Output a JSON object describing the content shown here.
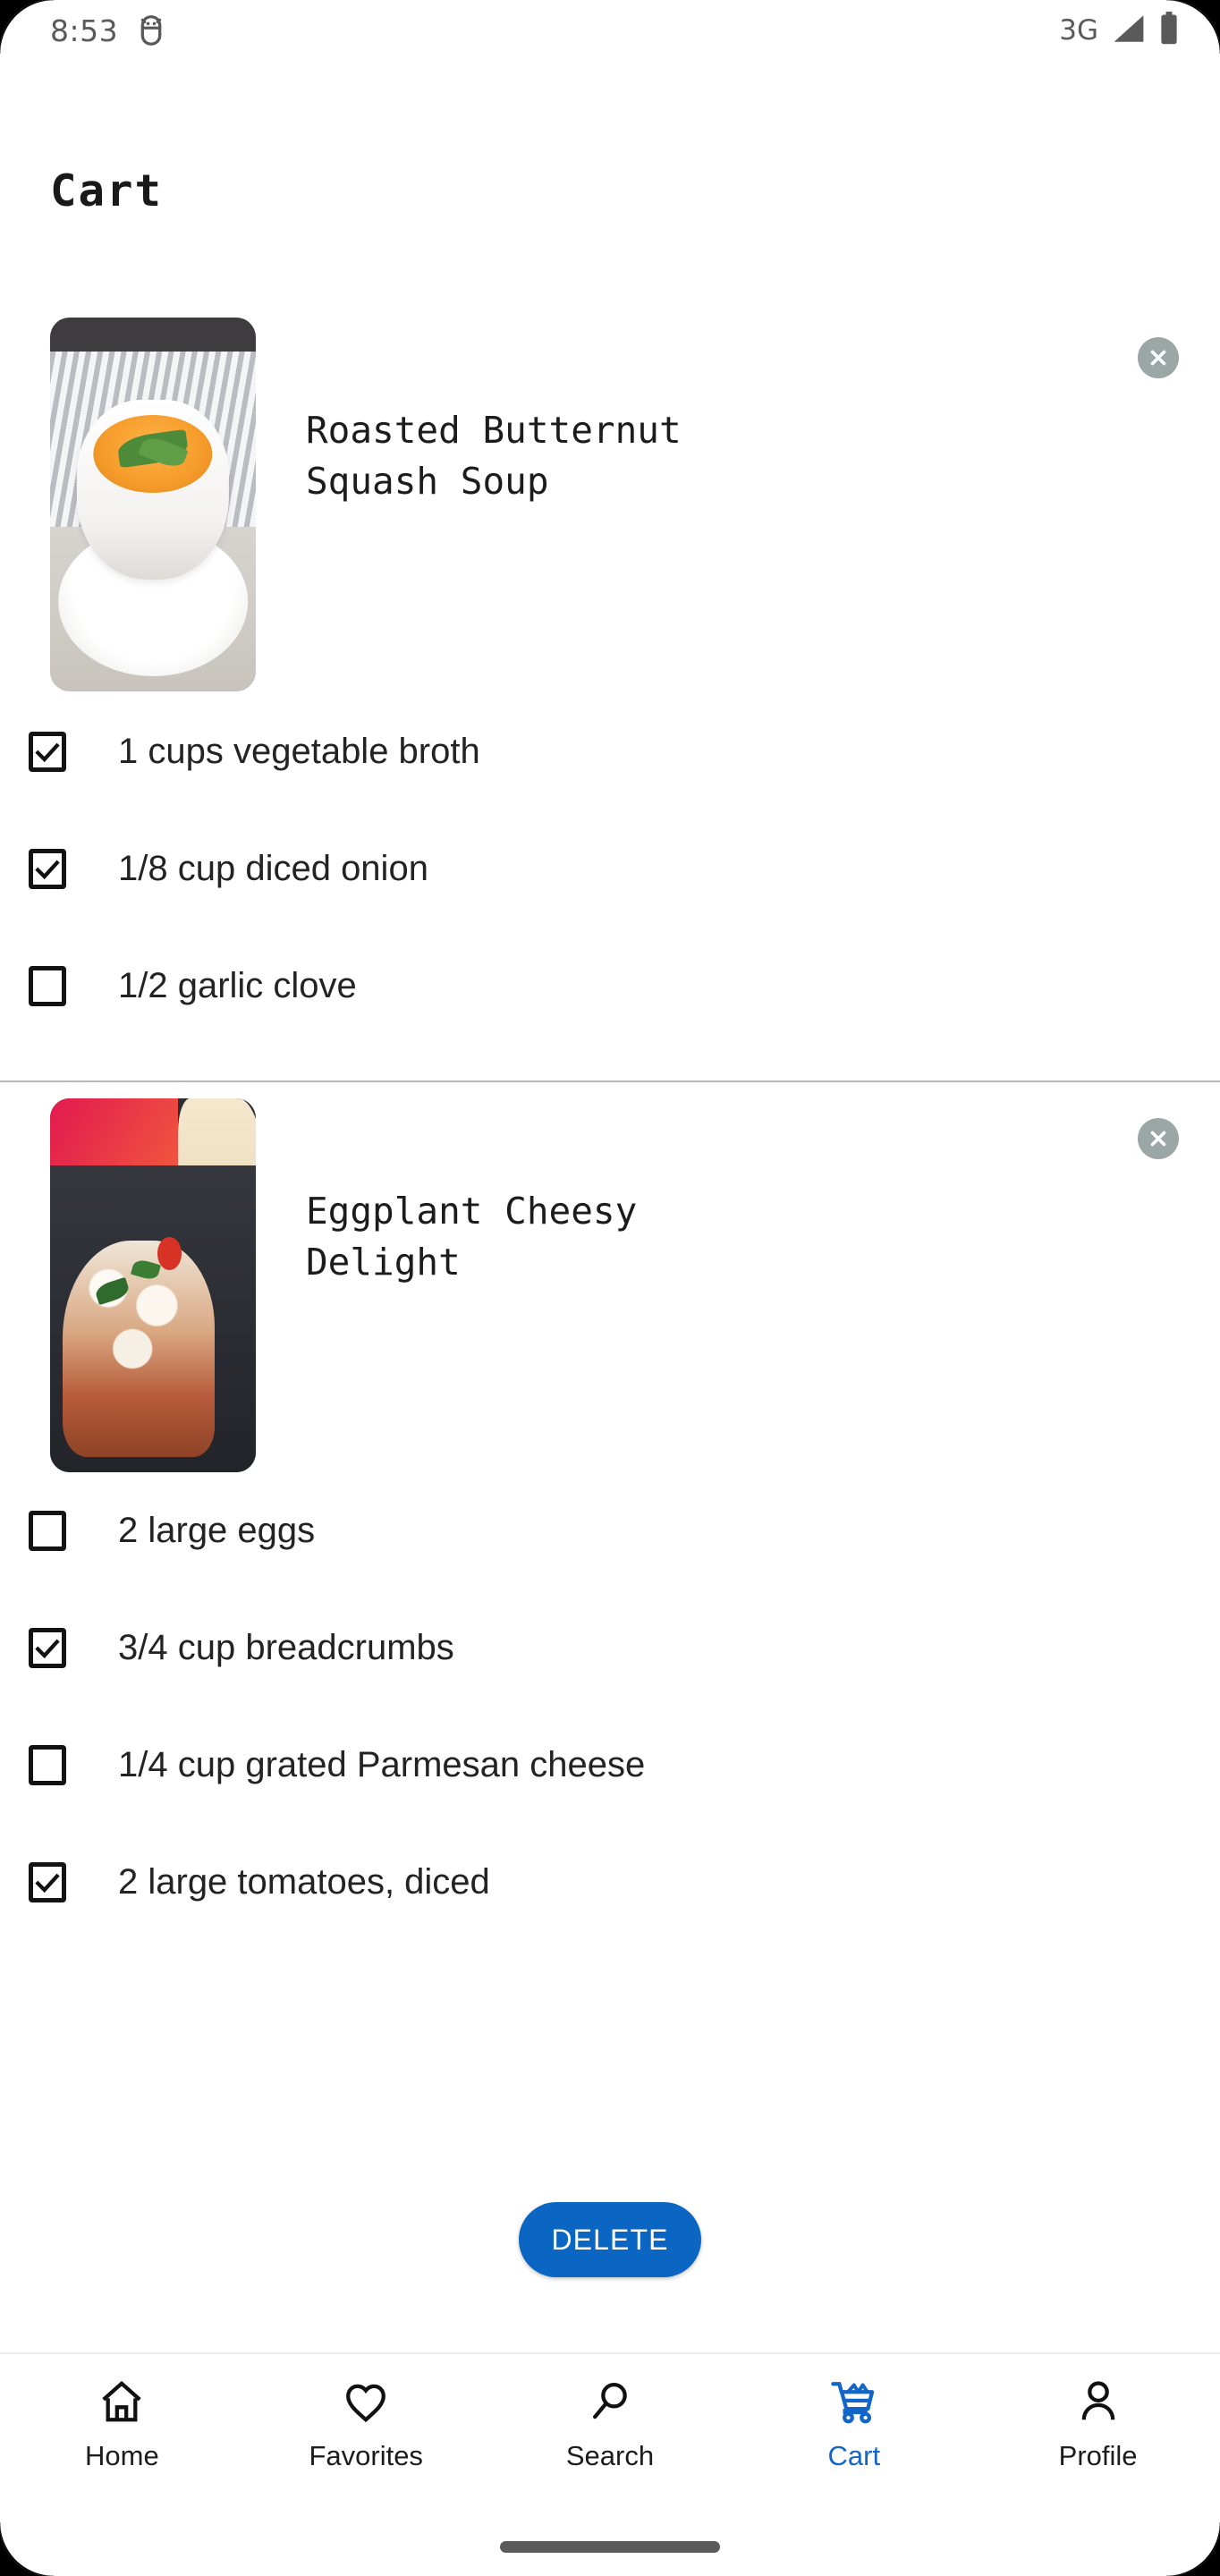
{
  "status_bar": {
    "time": "8:53",
    "app_icon": "android-robot-icon",
    "network": "3G",
    "signal_icon": "signal-bars-icon",
    "battery_icon": "battery-full-icon"
  },
  "header": {
    "title": "Cart"
  },
  "colors": {
    "accent_blue": "#0a66c2",
    "nav_active": "#1166c7",
    "remove_button": "#9aa7a5",
    "divider": "#b9b9b9",
    "text_primary": "#232323"
  },
  "cart": {
    "groups": [
      {
        "title": "Roasted Butternut Squash Soup",
        "image_alt": "roasted-butternut-squash-soup-photo",
        "remove_label": "close-icon",
        "ingredients": [
          {
            "label": "1 cups vegetable broth",
            "checked": true
          },
          {
            "label": "1/8 cup diced onion",
            "checked": true
          },
          {
            "label": "1/2 garlic clove",
            "checked": false
          }
        ]
      },
      {
        "title": "Eggplant Cheesy Delight",
        "image_alt": "eggplant-cheesy-delight-photo",
        "remove_label": "close-icon",
        "ingredients": [
          {
            "label": "2 large eggs",
            "checked": false
          },
          {
            "label": "3/4 cup breadcrumbs",
            "checked": true
          },
          {
            "label": "1/4 cup grated Parmesan cheese",
            "checked": false
          },
          {
            "label": "2 large tomatoes, diced",
            "checked": true
          }
        ]
      }
    ]
  },
  "actions": {
    "delete_label": "DELETE"
  },
  "bottom_nav": {
    "active_index": 3,
    "items": [
      {
        "label": "Home",
        "icon": "home-icon"
      },
      {
        "label": "Favorites",
        "icon": "heart-icon"
      },
      {
        "label": "Search",
        "icon": "search-icon"
      },
      {
        "label": "Cart",
        "icon": "shopping-cart-icon"
      },
      {
        "label": "Profile",
        "icon": "person-icon"
      }
    ]
  }
}
